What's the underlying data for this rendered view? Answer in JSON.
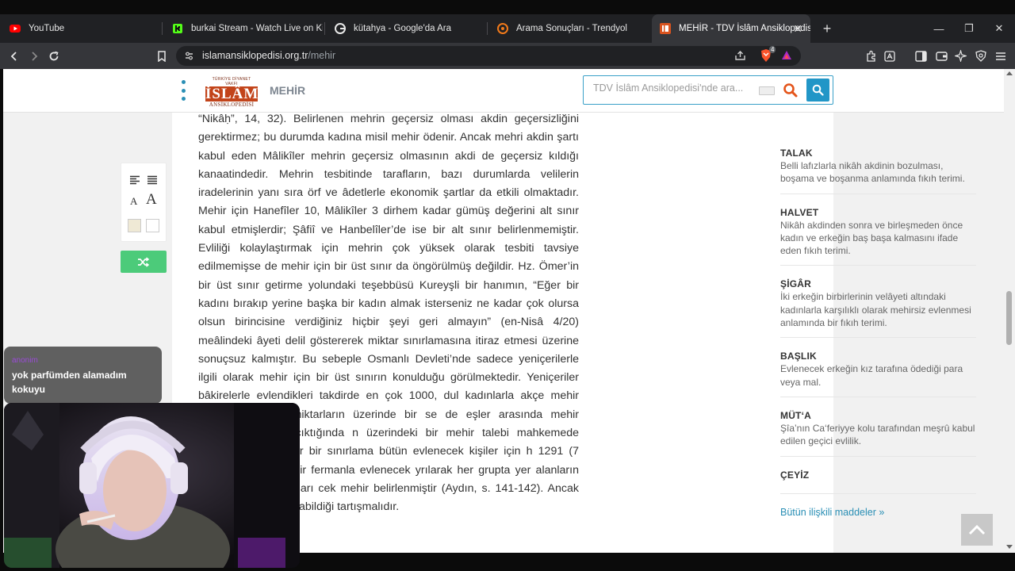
{
  "tabs": [
    {
      "label": "YouTube",
      "icon": "youtube-icon"
    },
    {
      "label": "burkai Stream - Watch Live on Kick",
      "icon": "kick-icon"
    },
    {
      "label": "kütahya - Google'da Ara",
      "icon": "google-icon"
    },
    {
      "label": "Arama Sonuçları - Trendyol",
      "icon": "trendyol-icon"
    },
    {
      "label": "MEHİR - TDV İslâm Ansiklopedisi",
      "icon": "islam-ansiklopedisi-icon",
      "active": true
    }
  ],
  "url": {
    "domain": "islamansiklopedisi.org.tr",
    "path": "/mehir"
  },
  "brave_badge": "4",
  "site": {
    "logo_top": "TÜRKİYE DİYANET VAKFI",
    "logo_main": "İSLÂM",
    "logo_bottom": "ANSİKLOPEDİSİ",
    "page_label": "MEHİR",
    "search_placeholder": "TDV İslâm Ansiklopedisi'nde ara...",
    "accent_color": "#2196c7"
  },
  "article": {
    "text": "“Nikâḥ”, 14, 32). Belirlenen mehrin geçersiz olması akdin geçersizliğini gerektirmez; bu durumda kadına misil mehir ödenir. Ancak mehri akdin şartı kabul eden Mâlikîler mehrin geçersiz olmasının akdi de geçersiz kıldığı kanaatindedir. Mehrin tesbitinde tarafların, bazı durumlarda velilerin iradelerinin yanı sıra örf ve âdetlerle ekonomik şartlar da etkili olmaktadır. Mehir için Hanefîler 10, Mâlikîler 3 dirhem kadar gümüş değerini alt sınır kabul etmişlerdir; Şâfiî ve Hanbelîler’de ise bir alt sınır belirlenmemiştir. Evliliği kolaylaştırmak için mehrin çok yüksek olarak tesbiti tavsiye edilmemişse de mehir için bir üst sınır da öngörülmüş değildir. Hz. Ömer’in bir üst sınır getirme yolundaki teşebbüsü Kureyşli bir hanımın, “Eğer bir kadını bırakıp yerine başka bir kadın almak isterseniz ne kadar çok olursa olsun birincisine verdiğiniz hiçbir şeyi geri almayın” (en-Nisâ 4/20) meâlindeki âyeti delil göstererek miktar sınırlamasına itiraz etmesi üzerine sonuçsuz kalmıştır. Bu sebeple Osmanlı Devleti’nde sadece yeniçerilerle ilgili olarak mehir için bir üst sınırın konulduğu görülmektedir. Yeniçeriler bâkirelerle evlendikleri takdirde en çok 1000, dul kadınlarla akçe mehir verebilirlerdi. Bu miktarların üzerinde bir se de eşler arasında mehir konusunda ihtilâf çıktığında n üzerindeki bir mehir talebi mahkemede dikkate yılda benzer bir sınırlama bütün evlenecek kişiler için h 1291 (7 Ekim 1874) tarihli bir fermanla evlenecek yrılarak her grupta yer alanların düğün için yapacakları cek mehir belirlenmiştir (Aydın, s. 141-142). Ancak bu e ölçüde uygulanabildiği tartışmalıdır."
  },
  "tools": {
    "font_small": "A",
    "font_large": "A"
  },
  "related": {
    "items": [
      {
        "title": "TALAK",
        "desc": "Belli lafızlarla nikâh akdinin bozulması, boşama ve boşanma anlamında fıkıh terimi."
      },
      {
        "title": "HALVET",
        "desc": "Nikâh akdinden sonra ve birleşmeden önce kadın ve erkeğin baş başa kalmasını ifade eden fıkıh terimi."
      },
      {
        "title": "ŞİGÂR",
        "desc": "İki erkeğin birbirlerinin velâyeti altındaki kadınlarla karşılıklı olarak mehirsiz evlenmesi anlamında bir fıkıh terimi."
      },
      {
        "title": "BAŞLIK",
        "desc": "Evlenecek erkeğin kız tarafına ödediği para veya mal."
      },
      {
        "title": "MÜT‘A",
        "desc": "Şîa’nın Ca‘feriyye kolu tarafından meşrû kabul edilen geçici evlilik."
      },
      {
        "title": "ÇEYİZ",
        "desc": ""
      }
    ],
    "all_link": "Bütün ilişkili maddeler »"
  },
  "overlay": {
    "chat_user": "anonim",
    "chat_message": "yok parfümden alamadım kokuyu"
  }
}
